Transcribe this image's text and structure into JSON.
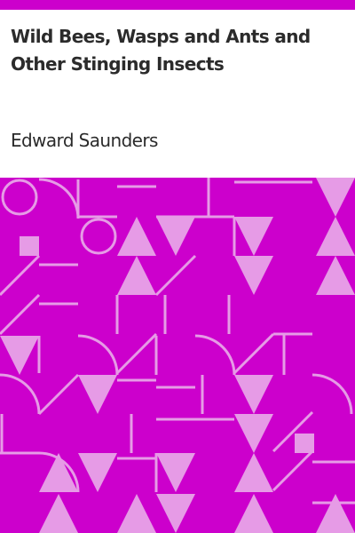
{
  "book": {
    "title": "Wild Bees, Wasps and Ants and Other Stinging Insects",
    "author": "Edward Saunders"
  },
  "colors": {
    "accent": "#cc00cc",
    "pattern_light": "#e69be6",
    "background": "#ffffff",
    "text": "#2b2b2b"
  }
}
